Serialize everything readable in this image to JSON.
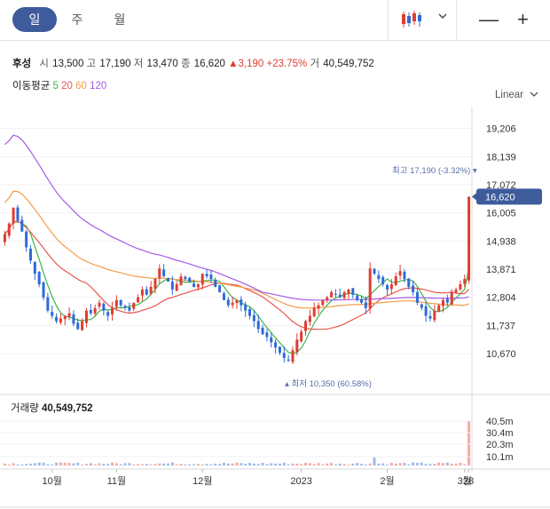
{
  "tabs": [
    {
      "label": "일",
      "active": true
    },
    {
      "label": "주",
      "active": false
    },
    {
      "label": "월",
      "active": false
    }
  ],
  "controls": {
    "minus_label": "—",
    "plus_label": "+"
  },
  "quote": {
    "name": "후성",
    "open_label": "시",
    "open": "13,500",
    "high_label": "고",
    "high": "17,190",
    "low_label": "저",
    "low": "13,470",
    "close_label": "종",
    "close": "16,620",
    "change": "▲3,190",
    "change_pct": "+23.75%",
    "volume_label": "거",
    "volume": "40,549,752"
  },
  "moving_average": {
    "title": "이동평균",
    "periods": [
      {
        "label": "5",
        "color": "#3cb44b"
      },
      {
        "label": "20",
        "color": "#e8584d"
      },
      {
        "label": "60",
        "color": "#f39c4a"
      },
      {
        "label": "120",
        "color": "#a55be8"
      }
    ]
  },
  "scale_mode": "Linear",
  "colors": {
    "up": "#e03c31",
    "down": "#2e6bd6",
    "accent": "#3e5b9c"
  },
  "chart_data": {
    "type": "candlestick",
    "y_ticks": [
      "19,206",
      "18,139",
      "17,072",
      "16,005",
      "14,938",
      "13,871",
      "12,804",
      "11,737",
      "10,670"
    ],
    "ylim": [
      10200,
      19700
    ],
    "x_ticks": [
      "10월",
      "11월",
      "12월",
      "2023",
      "2월",
      "3월",
      "28"
    ],
    "last_price_label": "16,620",
    "high_annotation": "최고 17,190 (-3.32%)",
    "low_annotation": "최저 10,350 (60.58%)",
    "closes": [
      15200,
      15600,
      16200,
      15700,
      15300,
      14700,
      14200,
      13700,
      13300,
      12800,
      12300,
      12100,
      11900,
      12000,
      12100,
      12200,
      11800,
      11600,
      11900,
      12300,
      12200,
      12400,
      12600,
      12300,
      12100,
      12400,
      12700,
      12500,
      12400,
      12300,
      12600,
      12800,
      13100,
      12900,
      13200,
      13500,
      13900,
      13600,
      13400,
      13100,
      13300,
      13600,
      13500,
      13400,
      13200,
      13300,
      13700,
      13600,
      13500,
      13200,
      13000,
      12700,
      12500,
      12600,
      12700,
      12500,
      12300,
      12100,
      11900,
      11600,
      11400,
      11300,
      11100,
      10900,
      10700,
      10500,
      10400,
      10800,
      11200,
      11500,
      11900,
      12100,
      12400,
      12500,
      12700,
      12800,
      13000,
      12900,
      12800,
      13000,
      13100,
      12900,
      12700,
      12600,
      12400,
      13900,
      13700,
      13500,
      13300,
      13100,
      13300,
      13600,
      13800,
      13500,
      13200,
      13000,
      12600,
      12400,
      12100,
      12000,
      12300,
      12500,
      12700,
      12600,
      13000,
      13100,
      13300,
      13500,
      16620
    ],
    "volume": {
      "title": "거래량",
      "total": "40,549,752",
      "ticks": [
        "40.5m",
        "30.4m",
        "20.3m",
        "10.1m"
      ],
      "max": 40549752
    }
  }
}
